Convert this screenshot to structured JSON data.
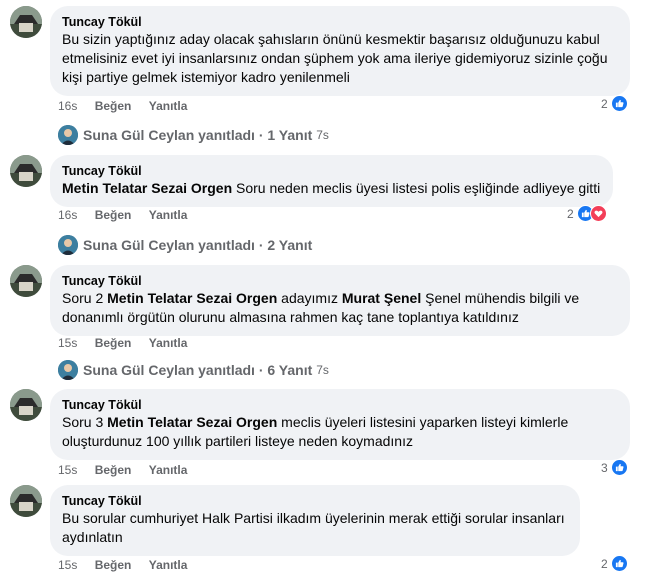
{
  "comments": [
    {
      "author": "Tuncay Tökül",
      "text": "Bu sizin yaptığınız aday olacak şahısların önünü kesmektir başarısız olduğunuzu kabul etmelisiniz evet iyi insanlarsınız ondan şüphem yok ama ileriye gidemiyoruz sizinle çoğu kişi partiye gelmek istemiyor kadro yenilenmeli",
      "time": "16s",
      "like_label": "Beğen",
      "reply_label": "Yanıtla",
      "reaction_count": "2",
      "reactions": [
        "like-icon"
      ]
    },
    {
      "author": "Tuncay Tökül",
      "tags": [
        "Metin Telatar",
        "Sezai Orgen"
      ],
      "text": "Soru neden meclis üyesi listesi polis eşliğinde adliyeye gitti",
      "time": "16s",
      "like_label": "Beğen",
      "reply_label": "Yanıtla",
      "reaction_count": "2",
      "reactions": [
        "like-icon",
        "love-icon"
      ]
    },
    {
      "author": "Tuncay Tökül",
      "text_before": "Soru 2",
      "tags": [
        "Metin Telatar",
        "Sezai Orgen"
      ],
      "text_mid": "adayımız",
      "tag2": "Murat Şenel",
      "text_after": "Şenel mühendis bilgili ve donanımlı örgütün olurunu almasına rahmen kaç tane toplantıya katıldınız",
      "time": "15s",
      "like_label": "Beğen",
      "reply_label": "Yanıtla"
    },
    {
      "author": "Tuncay Tökül",
      "text_before": "Soru 3",
      "tags": [
        "Metin Telatar",
        "Sezai Orgen"
      ],
      "text_after": "meclis üyeleri listesini yaparken listeyi kimlerle oluşturdunuz 100 yıllık partileri listeye neden koymadınız",
      "time": "15s",
      "like_label": "Beğen",
      "reply_label": "Yanıtla",
      "reaction_count": "3",
      "reactions": [
        "like-icon"
      ]
    },
    {
      "author": "Tuncay Tökül",
      "text": "Bu sorular cumhuriyet Halk Partisi ilkadım üyelerinin merak ettiği sorular insanları aydınlatın",
      "time": "15s",
      "like_label": "Beğen",
      "reply_label": "Yanıtla",
      "reaction_count": "2",
      "reactions": [
        "like-icon"
      ]
    }
  ],
  "reply_summaries": [
    {
      "text": "Suna Gül Ceylan yanıtladı · 1 Yanıt",
      "time": "7s"
    },
    {
      "text": "Suna Gül Ceylan yanıtladı · 2 Yanıt",
      "time": ""
    },
    {
      "text": "Suna Gül Ceylan yanıtladı · 6 Yanıt",
      "time": "7s"
    }
  ],
  "colors": {
    "bubble": "#f0f2f5",
    "like": "#1877f2",
    "love": "#f33e58",
    "meta": "#65676b"
  }
}
